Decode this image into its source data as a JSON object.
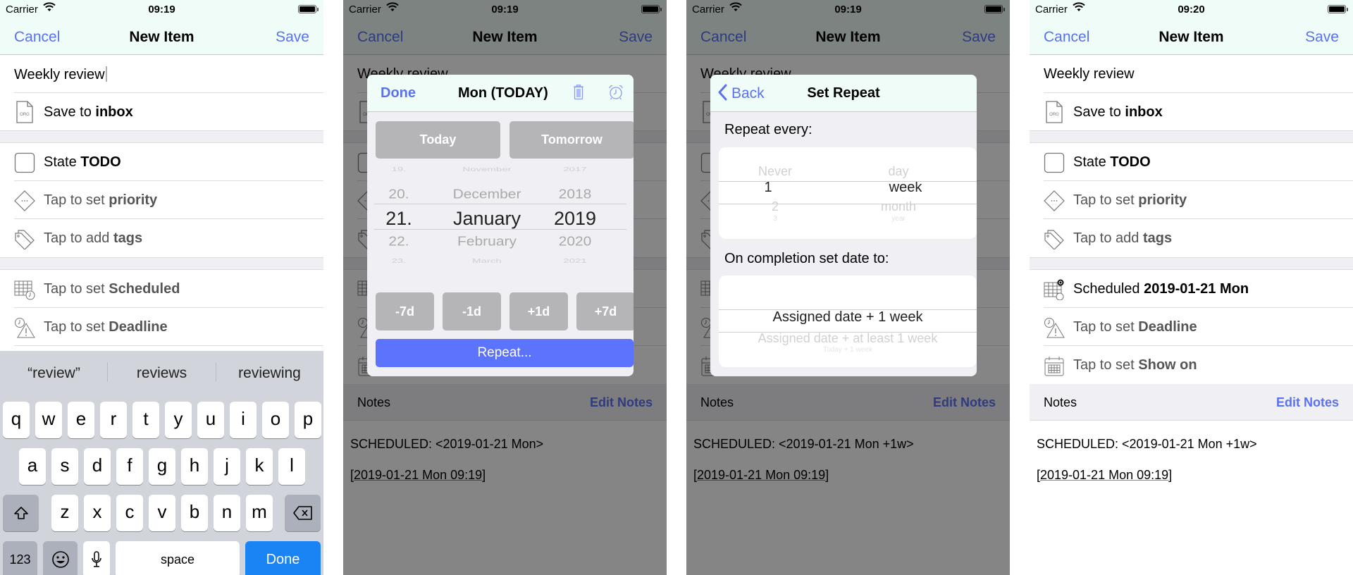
{
  "accent_color": "#5a72f2",
  "screens": [
    {
      "status": {
        "carrier": "Carrier",
        "time": "09:19"
      },
      "nav": {
        "cancel": "Cancel",
        "title": "New Item",
        "save": "Save"
      },
      "title_value": "Weekly review",
      "save_to": {
        "prefix": "Save to ",
        "value": "inbox"
      },
      "state": {
        "prefix": "State ",
        "value": "TODO"
      },
      "priority": {
        "prefix": "Tap to set ",
        "value": "priority"
      },
      "tags": {
        "prefix": "Tap to add ",
        "value": "tags"
      },
      "scheduled": {
        "prefix": "Tap to set ",
        "value": "Scheduled"
      },
      "deadline": {
        "prefix": "Tap to set ",
        "value": "Deadline"
      },
      "keyboard": {
        "suggestions": [
          "“review”",
          "reviews",
          "reviewing"
        ],
        "row1": [
          "q",
          "w",
          "e",
          "r",
          "t",
          "y",
          "u",
          "i",
          "o",
          "p"
        ],
        "row2": [
          "a",
          "s",
          "d",
          "f",
          "g",
          "h",
          "j",
          "k",
          "l"
        ],
        "row3": [
          "z",
          "x",
          "c",
          "v",
          "b",
          "n",
          "m"
        ],
        "numbers_key": "123",
        "space_key": "space",
        "done_key": "Done"
      }
    },
    {
      "status": {
        "carrier": "Carrier",
        "time": "09:19"
      },
      "nav": {
        "cancel": "Cancel",
        "title": "New Item",
        "save": "Save"
      },
      "title_value": "Weekly review",
      "notes": {
        "header": "Notes",
        "edit": "Edit Notes",
        "line1": "SCHEDULED: <2019-01-21 Mon>",
        "line2": "[2019-01-21 Mon 09:19]"
      },
      "date_modal": {
        "done": "Done",
        "title": "Mon (TODAY)",
        "today": "Today",
        "tomorrow": "Tomorrow",
        "day_col": [
          "19.",
          "20.",
          "21.",
          "22.",
          "23."
        ],
        "month_col": [
          "November",
          "December",
          "January",
          "February",
          "March"
        ],
        "year_col": [
          "2017",
          "2018",
          "2019",
          "2020",
          "2021"
        ],
        "selected": {
          "day": "21.",
          "month": "January",
          "year": "2019"
        },
        "shift_buttons": [
          "-7d",
          "-1d",
          "+1d",
          "+7d"
        ],
        "repeat": "Repeat..."
      }
    },
    {
      "status": {
        "carrier": "Carrier",
        "time": "09:19"
      },
      "nav": {
        "cancel": "Cancel",
        "title": "New Item",
        "save": "Save"
      },
      "title_value": "Weekly review",
      "notes": {
        "header": "Notes",
        "edit": "Edit Notes",
        "line1": "SCHEDULED: <2019-01-21 Mon +1w>",
        "line2": "[2019-01-21 Mon 09:19]"
      },
      "repeat_modal": {
        "back": "Back",
        "title": "Set Repeat",
        "repeat_every_label": "Repeat every:",
        "count_col": [
          "Never",
          "1",
          "2",
          "3"
        ],
        "unit_col": [
          "day",
          "week",
          "month",
          "year"
        ],
        "selected": {
          "count": "1",
          "unit": "week"
        },
        "completion_label": "On completion set date to:",
        "completion_options": [
          "Assigned date + 1 week",
          "Assigned date + at least 1 week",
          "Today + 1 week"
        ],
        "completion_selected": "Assigned date + 1 week"
      }
    },
    {
      "status": {
        "carrier": "Carrier",
        "time": "09:20"
      },
      "nav": {
        "cancel": "Cancel",
        "title": "New Item",
        "save": "Save"
      },
      "title_value": "Weekly review",
      "save_to": {
        "prefix": "Save to ",
        "value": "inbox"
      },
      "state": {
        "prefix": "State ",
        "value": "TODO"
      },
      "priority": {
        "prefix": "Tap to set ",
        "value": "priority"
      },
      "tags": {
        "prefix": "Tap to add ",
        "value": "tags"
      },
      "scheduled": {
        "prefix": "Scheduled ",
        "value": "2019-01-21 Mon"
      },
      "deadline": {
        "prefix": "Tap to set ",
        "value": "Deadline"
      },
      "show_on": {
        "prefix": "Tap to set ",
        "value": "Show on"
      },
      "notes": {
        "header": "Notes",
        "edit": "Edit Notes",
        "line1": "SCHEDULED: <2019-01-21 Mon +1w>",
        "line2": "[2019-01-21 Mon 09:19]"
      }
    }
  ]
}
